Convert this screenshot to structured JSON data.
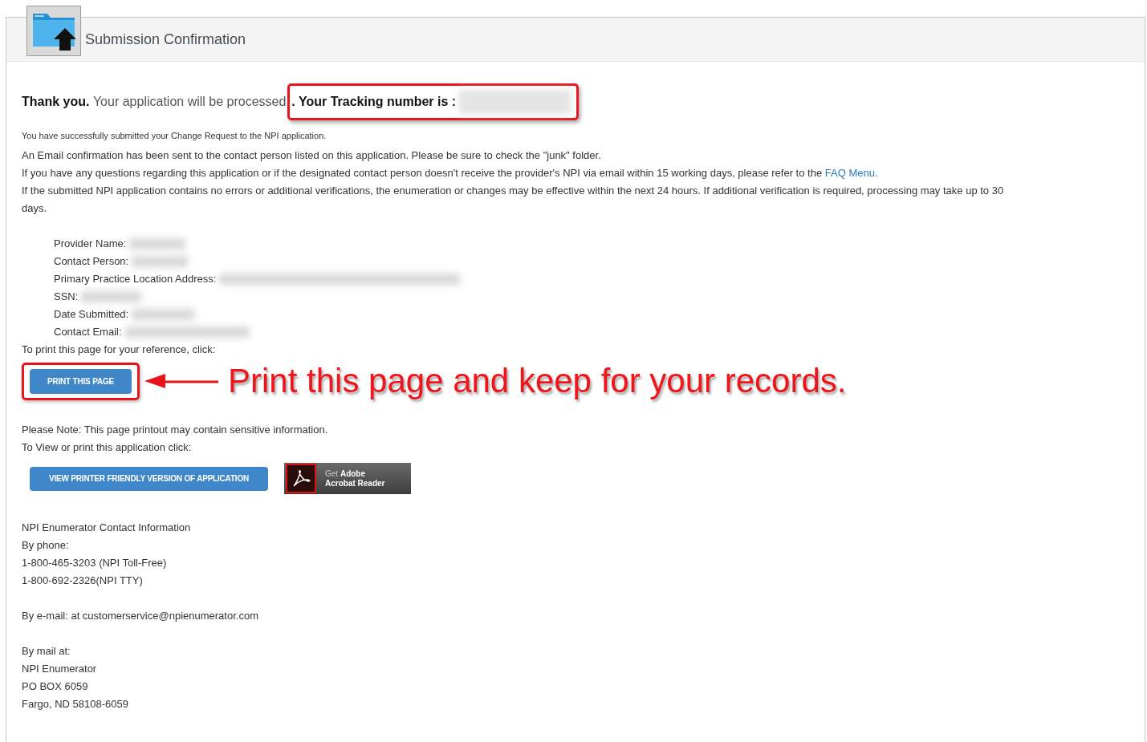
{
  "header": {
    "title": "Submission Confirmation"
  },
  "thank_you": {
    "lead": "Thank you.",
    "text": "Your application will be processed",
    "tracking_label": ". Your Tracking number is :",
    "tracking_redacted": true,
    "highlighted": true
  },
  "success_note": "You have successfully submitted your Change Request to the NPI application.",
  "info_paragraphs": [
    {
      "text": "An Email confirmation has been sent to the contact person listed on this application. Please be sure to check the \"junk\" folder."
    },
    {
      "text": "If you have any questions regarding this application or if the designated contact person doesn't receive the provider's NPI via email within 15 working days,  please refer to the ",
      "link": "FAQ Menu."
    },
    {
      "text": "If the submitted NPI application contains no errors or additional verifications, the enumeration or changes may be effective within the next 24 hours. If additional verification is required, processing may take up to 30 days."
    }
  ],
  "fields": [
    {
      "label": "Provider Name:",
      "redacted": true
    },
    {
      "label": "Contact Person:",
      "redacted": true
    },
    {
      "label": "Primary Practice Location Address:",
      "redacted": true
    },
    {
      "label": "SSN:",
      "redacted": true
    },
    {
      "label": "Date Submitted:",
      "redacted": true
    },
    {
      "label": "Contact Email:",
      "redacted": true
    }
  ],
  "print_prompt": "To print this page for your reference, click:",
  "print_button": {
    "label": "PRINT THIS PAGE",
    "highlighted": true
  },
  "annotation": "Print this page and keep for your records.",
  "notes": [
    "Please Note: This page printout may contain sensitive information.",
    "To View or print this application click:"
  ],
  "view_button": {
    "label": "VIEW PRINTER FRIENDLY VERSION OF APPLICATION"
  },
  "adobe_badge": {
    "line1": "Get **Adobe**",
    "line2": "Acrobat Reader"
  },
  "contact_groups": [
    [
      "NPI Enumerator Contact Information",
      "By phone:",
      "1-800-465-3203 (NPI Toll-Free)",
      "1-800-692-2326(NPI TTY)"
    ],
    [
      "By e-mail: at customerservice@npienumerator.com"
    ],
    [
      "By mail at:",
      "NPI Enumerator",
      "PO BOX 6059",
      "Fargo, ND 58108-6059"
    ]
  ]
}
